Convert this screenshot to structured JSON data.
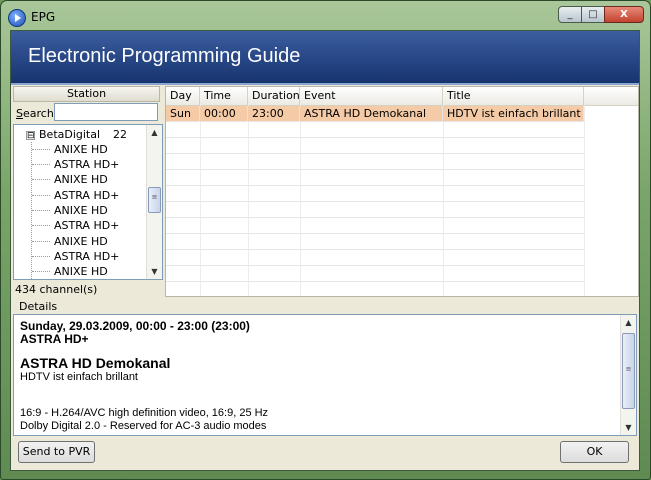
{
  "window": {
    "title": "EPG",
    "minimize_glyph": "_",
    "maximize_glyph": "□",
    "close_glyph": "X"
  },
  "banner": {
    "title": "Electronic Programming Guide"
  },
  "station_panel": {
    "header": "Station",
    "search_label": "Search",
    "search_value": "",
    "group": {
      "expander": "⊟",
      "name": "BetaDigital",
      "count": "22"
    },
    "channels": [
      "ANIXE HD",
      "ASTRA HD+",
      "ANIXE HD",
      "ASTRA HD+",
      "ANIXE HD",
      "ASTRA HD+",
      "ANIXE HD",
      "ASTRA HD+",
      "ANIXE HD"
    ],
    "channel_count": "434 channel(s)"
  },
  "guide": {
    "columns": [
      "Day",
      "Time",
      "Duration",
      "Event",
      "Title"
    ],
    "rows": [
      {
        "day": "Sun",
        "time": "00:00",
        "duration": "23:00",
        "event": "ASTRA HD Demokanal",
        "title": "HDTV ist einfach brillant"
      }
    ]
  },
  "details": {
    "label": "Details",
    "datetime": "Sunday, 29.03.2009, 00:00 - 23:00  (23:00)",
    "channel": "ASTRA HD+",
    "event": "ASTRA HD Demokanal",
    "title": "HDTV ist einfach brillant",
    "video": "16:9 - H.264/AVC high definition video, 16:9, 25 Hz",
    "audio": "Dolby Digital 2.0 - Reserved for AC-3 audio modes"
  },
  "buttons": {
    "send_to_pvr": "Send to PVR",
    "ok": "OK"
  },
  "colors": {
    "banner": "#2a4a8a",
    "selected_row": "#f5cba7"
  },
  "icons": [
    "app-icon",
    "expander-icon",
    "scroll-up-icon",
    "scroll-down-icon",
    "scroll-thumb-grip-icon"
  ]
}
